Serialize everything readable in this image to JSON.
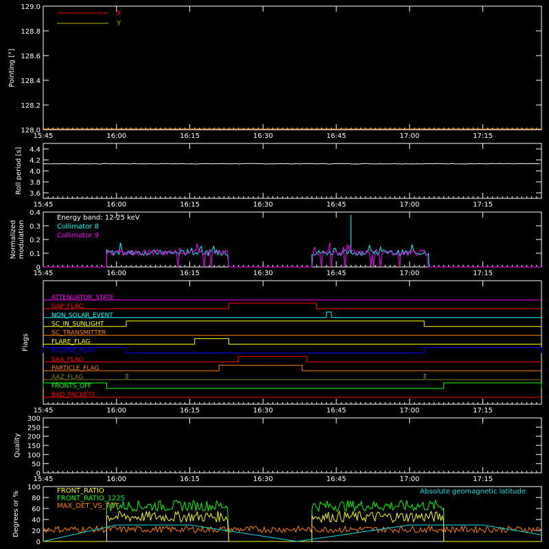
{
  "time_axis": {
    "start": "15:45",
    "end": "17:27",
    "tick_labels": [
      "15:45",
      "16:00",
      "16:15",
      "16:30",
      "16:45",
      "17:00",
      "17:15"
    ]
  },
  "colors": {
    "axis": "#ffffff",
    "background": "#000000",
    "x_series": "#ff0000",
    "y_series": "#b5b000",
    "collimator_8": "#00ffff",
    "collimator_9": "#ff00ff",
    "front_ratio": "#ffff00",
    "front_ratio_1225": "#00ff00",
    "max_det_vs_tot": "#ff8000",
    "geomag_latitude": "#00e5e5"
  },
  "chart_data": [
    {
      "id": "pointing",
      "type": "line",
      "ylabel": "Pointing [°]",
      "ylim": [
        128.0,
        129.0
      ],
      "ytick_labels": [
        "128.0",
        "128.2",
        "128.4",
        "128.6",
        "128.8",
        "129.0"
      ],
      "legend": {
        "placement": "top-left",
        "entries": [
          "X",
          "Y"
        ]
      },
      "series": [
        {
          "name": "X",
          "values": []
        },
        {
          "name": "Y",
          "values": []
        }
      ]
    },
    {
      "id": "roll_period",
      "type": "line",
      "ylabel": "Roll period [s]",
      "ylim": [
        3.5,
        4.5
      ],
      "ytick_labels": [
        "3.6",
        "3.8",
        "4.0",
        "4.2",
        "4.4"
      ],
      "series": [
        {
          "x": [
            "15:45",
            "17:27"
          ],
          "values": [
            4.13,
            4.13
          ]
        }
      ]
    },
    {
      "id": "modulation",
      "type": "line",
      "ylabel": "Normalized modulation",
      "ylim": [
        0,
        0.4
      ],
      "ytick_labels": [
        "0",
        "0.1",
        "0.2",
        "0.3",
        "0.4"
      ],
      "annotation": "Energy band: 12-25 keV",
      "legend": {
        "placement": "top-left",
        "entries": [
          "Collimator 8",
          "Collimator 9"
        ]
      },
      "series": [
        {
          "name": "Collimator 8",
          "segments": [
            [
              "15:58",
              "16:23"
            ],
            [
              "16:40",
              "17:04"
            ]
          ],
          "typical": 0.1,
          "spikes": [
            [
              "16:48",
              0.38
            ]
          ]
        },
        {
          "name": "Collimator 9",
          "segments": [
            [
              "15:58",
              "16:23"
            ],
            [
              "16:40",
              "17:04"
            ]
          ],
          "typical": 0.1,
          "spikes": []
        }
      ]
    },
    {
      "id": "flags",
      "type": "line",
      "ylabel": "Flags",
      "flags": [
        {
          "name": "ATTENUATOR_STATE",
          "color": "#ff00ff",
          "high": []
        },
        {
          "name": "GAP_FLAG",
          "color": "#ff0000",
          "high": [
            [
              "16:23",
              "16:41"
            ]
          ]
        },
        {
          "name": "NON_SOLAR_EVENT",
          "color": "#00ffff",
          "high": [
            [
              "16:43",
              "16:44"
            ]
          ]
        },
        {
          "name": "SC_IN_SUNLIGHT",
          "color": "#ffff00",
          "high": [
            [
              "16:02",
              "17:03"
            ]
          ]
        },
        {
          "name": "SC_TRANSMITTER",
          "color": "#ff8000",
          "high": []
        },
        {
          "name": "FLARE_FLAG",
          "color": "#ffff00",
          "high": [
            [
              "16:16",
              "16:23"
            ]
          ]
        },
        {
          "name": "ECLIPSE_FLAG",
          "color": "#0000ff",
          "high": [
            [
              "15:45",
              "16:02"
            ],
            [
              "17:03",
              "17:27"
            ]
          ]
        },
        {
          "name": "SAA_FLAG",
          "color": "#ff0000",
          "high": [
            [
              "16:25",
              "16:39"
            ]
          ]
        },
        {
          "name": "PARTICLE_FLAG",
          "color": "#ff8000",
          "high": [
            [
              "16:21",
              "16:38"
            ]
          ]
        },
        {
          "name": "AAZ_FLAG",
          "color": "#808000",
          "high": [
            [
              "16:02",
              "16:02"
            ],
            [
              "17:03",
              "17:03"
            ]
          ]
        },
        {
          "name": "FRONTS_OFF",
          "color": "#00ff00",
          "high": [
            [
              "15:45",
              "15:58"
            ],
            [
              "17:07",
              "17:27"
            ]
          ]
        },
        {
          "name": "BAD_PACKETS",
          "color": "#ff0000",
          "high": []
        }
      ]
    },
    {
      "id": "quality",
      "type": "line",
      "ylabel": "Quality",
      "ylim": [
        0,
        300
      ],
      "ytick_labels": [
        "0",
        "50",
        "100",
        "150",
        "200",
        "250",
        "300"
      ],
      "series": []
    },
    {
      "id": "ratios",
      "type": "line",
      "ylabel": "Degrees or %",
      "ylim": [
        0,
        100
      ],
      "ytick_labels": [
        "0",
        "20",
        "40",
        "60",
        "80",
        "100"
      ],
      "annotation": "Absolute geomagnetic latitude",
      "legend": {
        "placement": "top-left",
        "entries": [
          "FRONT_RATIO",
          "FRONT_RATIO_1225",
          "MAX_DET_VS_TOT"
        ]
      },
      "series": [
        {
          "name": "FRONT_RATIO_1225",
          "segments": [
            [
              "15:58",
              "16:23"
            ],
            [
              "16:40",
              "17:07"
            ]
          ],
          "typical": 65
        },
        {
          "name": "FRONT_RATIO",
          "segments": [
            [
              "15:58",
              "16:23"
            ],
            [
              "16:40",
              "17:07"
            ]
          ],
          "typical": 45
        },
        {
          "name": "MAX_DET_VS_TOT",
          "typical": 22
        },
        {
          "name": "Absolute geomagnetic latitude",
          "x": [
            "15:45",
            "16:00",
            "16:15",
            "16:37",
            "17:00",
            "17:15",
            "17:27"
          ],
          "values": [
            0,
            30,
            30,
            0,
            30,
            30,
            12
          ]
        }
      ]
    }
  ]
}
